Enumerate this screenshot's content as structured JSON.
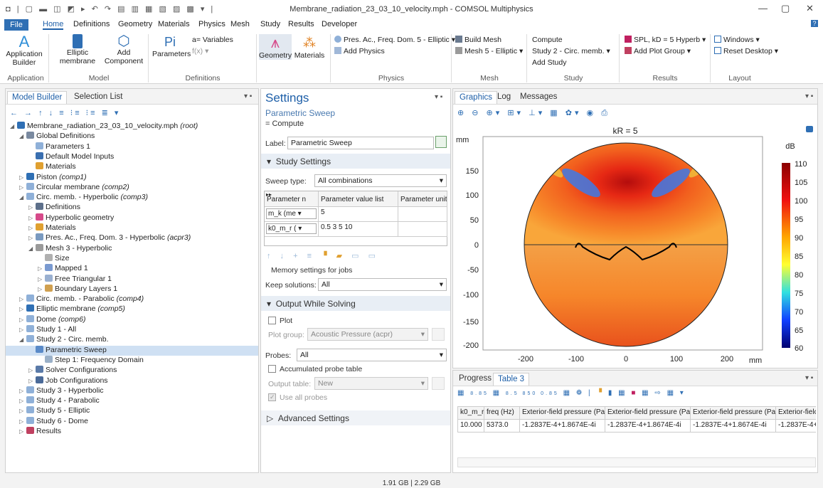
{
  "window": {
    "title": "Membrane_radiation_23_03_10_velocity.mph - COMSOL Multiphysics"
  },
  "menu": {
    "file": "File",
    "items": [
      "Home",
      "Definitions",
      "Geometry",
      "Materials",
      "Physics",
      "Mesh",
      "Study",
      "Results",
      "Developer"
    ]
  },
  "ribbon": {
    "app_builder": "Application Builder",
    "elliptic_membrane": "Elliptic membrane",
    "add_component": "Add Component",
    "variables": "a= Variables",
    "parameters": "Parameters",
    "pi": "Pi",
    "geometry": "Geometry",
    "materials": "Materials",
    "physics_iface": "Pres. Ac., Freq. Dom. 5 - Elliptic",
    "add_physics": "Add Physics",
    "build_mesh": "Build Mesh",
    "mesh5": "Mesh 5 - Elliptic",
    "compute": "Compute",
    "study2": "Study 2 - Circ. memb.",
    "add_study": "Add Study",
    "spl": "SPL, kD = 5 Hyperb",
    "add_plot_group": "Add Plot Group",
    "windows": "Windows",
    "reset_desktop": "Reset Desktop",
    "groups": [
      "Application",
      "Model",
      "Definitions",
      "Physics",
      "Mesh",
      "Study",
      "Results",
      "Layout"
    ]
  },
  "model_builder": {
    "tabs": [
      "Model Builder",
      "Selection List"
    ],
    "tree": [
      {
        "text": "Membrane_radiation_23_03_10_velocity.mph",
        "em": "(root)",
        "level": 0,
        "exp": "◢",
        "color": "#2f6fb4"
      },
      {
        "text": "Global Definitions",
        "em": "",
        "level": 1,
        "exp": "◢",
        "color": "#7a8aa0"
      },
      {
        "text": "Parameters 1",
        "em": "",
        "level": 2,
        "exp": "",
        "color": "#8fb0d8"
      },
      {
        "text": "Default Model Inputs",
        "em": "",
        "level": 2,
        "exp": "",
        "color": "#3a6fb0"
      },
      {
        "text": "Materials",
        "em": "",
        "level": 2,
        "exp": "",
        "color": "#e0a030"
      },
      {
        "text": "Piston",
        "em": "(comp1)",
        "level": 1,
        "exp": "▷",
        "color": "#2f6fb4"
      },
      {
        "text": "Circular membrane",
        "em": "(comp2)",
        "level": 1,
        "exp": "▷",
        "color": "#8fb0d8"
      },
      {
        "text": "Circ. memb. - Hyperbolic",
        "em": "(comp3)",
        "level": 1,
        "exp": "◢",
        "color": "#8fb0d8"
      },
      {
        "text": "Definitions",
        "em": "",
        "level": 2,
        "exp": "▷",
        "color": "#5d6f8a"
      },
      {
        "text": "Hyperbolic geometry",
        "em": "",
        "level": 2,
        "exp": "▷",
        "color": "#d64a8a"
      },
      {
        "text": "Materials",
        "em": "",
        "level": 2,
        "exp": "▷",
        "color": "#e0a030"
      },
      {
        "text": "Pres. Ac., Freq. Dom. 3 - Hyperbolic",
        "em": "(acpr3)",
        "level": 2,
        "exp": "▷",
        "color": "#7a9ac0"
      },
      {
        "text": "Mesh 3 - Hyperbolic",
        "em": "",
        "level": 2,
        "exp": "◢",
        "color": "#9a9a9a"
      },
      {
        "text": "Size",
        "em": "",
        "level": 3,
        "exp": "",
        "color": "#b0b0b0"
      },
      {
        "text": "Mapped 1",
        "em": "",
        "level": 3,
        "exp": "▷",
        "color": "#7a9ad0"
      },
      {
        "text": "Free Triangular 1",
        "em": "",
        "level": 3,
        "exp": "▷",
        "color": "#9ab0d0"
      },
      {
        "text": "Boundary Layers 1",
        "em": "",
        "level": 3,
        "exp": "▷",
        "color": "#d0a050"
      },
      {
        "text": "Circ. memb. - Parabolic",
        "em": "(comp4)",
        "level": 1,
        "exp": "▷",
        "color": "#8fb0d8"
      },
      {
        "text": "Elliptic membrane",
        "em": "(comp5)",
        "level": 1,
        "exp": "▷",
        "color": "#2f6fb4"
      },
      {
        "text": "Dome",
        "em": "(comp6)",
        "level": 1,
        "exp": "▷",
        "color": "#8fb0d8"
      },
      {
        "text": "Study 1 - All",
        "em": "",
        "level": 1,
        "exp": "▷",
        "color": "#8fb0d8"
      },
      {
        "text": "Study 2 - Circ. memb.",
        "em": "",
        "level": 1,
        "exp": "◢",
        "color": "#8fb0d8"
      },
      {
        "text": "Parametric Sweep",
        "em": "",
        "level": 2,
        "exp": "",
        "color": "#5a8ac8",
        "sel": true
      },
      {
        "text": "Step 1: Frequency Domain",
        "em": "",
        "level": 3,
        "exp": "",
        "color": "#9ab0c8"
      },
      {
        "text": "Solver Configurations",
        "em": "",
        "level": 2,
        "exp": "▷",
        "color": "#5a7aa8"
      },
      {
        "text": "Job Configurations",
        "em": "",
        "level": 2,
        "exp": "▷",
        "color": "#4a6a98"
      },
      {
        "text": "Study 3 - Hyperbolic",
        "em": "",
        "level": 1,
        "exp": "▷",
        "color": "#8fb0d8"
      },
      {
        "text": "Study 4 - Parabolic",
        "em": "",
        "level": 1,
        "exp": "▷",
        "color": "#8fb0d8"
      },
      {
        "text": "Study 5 - Elliptic",
        "em": "",
        "level": 1,
        "exp": "▷",
        "color": "#8fb0d8"
      },
      {
        "text": "Study 6 - Dome",
        "em": "",
        "level": 1,
        "exp": "▷",
        "color": "#8fb0d8"
      },
      {
        "text": "Results",
        "em": "",
        "level": 1,
        "exp": "▷",
        "color": "#c04060"
      }
    ]
  },
  "settings": {
    "title": "Settings",
    "subtitle": "Parametric Sweep",
    "compute": "= Compute",
    "label_caption": "Label:",
    "label_value": "Parametric Sweep",
    "study_settings": "Study Settings",
    "sweep_type_label": "Sweep type:",
    "sweep_type": "All combinations",
    "col_param": "Parameter n",
    "col_values": "Parameter value list",
    "col_unit": "Parameter unit",
    "rows": [
      {
        "name": "m_k (me",
        "values": "5",
        "unit": ""
      },
      {
        "name": "k0_m_r (",
        "values": "0.5 3 5 10",
        "unit": ""
      }
    ],
    "memory": "Memory settings for jobs",
    "keep_label": "Keep solutions:",
    "keep_value": "All",
    "output_head": "Output While Solving",
    "plot": "Plot",
    "plot_group_label": "Plot group:",
    "plot_group": "Acoustic Pressure (acpr)",
    "probes_label": "Probes:",
    "probes_value": "All",
    "accum": "Accumulated probe table",
    "output_table_label": "Output table:",
    "output_table": "New",
    "use_all": "Use all probes",
    "advanced": "Advanced Settings"
  },
  "graphics": {
    "tabs": [
      "Graphics",
      "Log",
      "Messages"
    ],
    "plot_title": "kR = 5",
    "unit": "mm",
    "xticks": [
      "-200",
      "-100",
      "0",
      "100",
      "200"
    ],
    "yticks": [
      "150",
      "100",
      "50",
      "0",
      "-50",
      "-100",
      "-150",
      "-200"
    ],
    "colorbar_unit": "dB",
    "colorbar_ticks": [
      "110",
      "105",
      "100",
      "95",
      "90",
      "85",
      "80",
      "75",
      "70",
      "65",
      "60"
    ]
  },
  "table_panel": {
    "tabs": [
      "Progress",
      "Table 3"
    ],
    "headers": [
      "k0_m_r",
      "freq (Hz)",
      "Exterior-field pressure (Pa)",
      "Exterior-field pressure (Pa)",
      "Exterior-field pressure (Pa)",
      "Exterior-fielc"
    ],
    "row": [
      "10.000",
      "5373.0",
      "-1.2837E-4+1.8674E-4i",
      "-1.2837E-4+1.8674E-4i",
      "-1.2837E-4+1.8674E-4i",
      "-1.2837E-4+1"
    ]
  },
  "status": {
    "memory": "1.91 GB | 2.29 GB"
  }
}
